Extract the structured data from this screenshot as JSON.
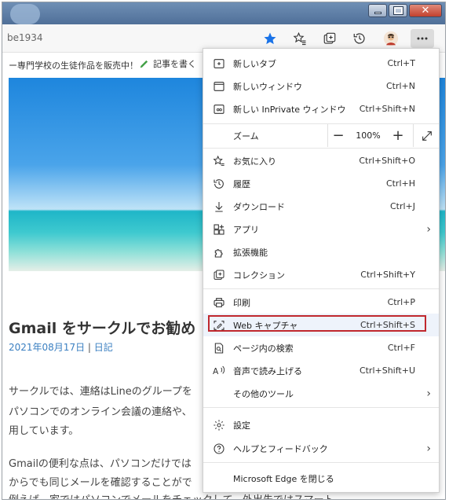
{
  "browser": {
    "url": "be1934",
    "toolbar_icons": [
      "favorite-star-icon",
      "favorites-list-icon",
      "collections-icon",
      "history-icon",
      "profile-avatar",
      "more-menu-icon"
    ]
  },
  "page": {
    "banner_text": "ー専門学校の生徒作品を販売中！",
    "write_button": "記事を書く",
    "article_title": "Gmail をサークルでお勧め",
    "article_date": "2021年08月17日",
    "article_category": "日記",
    "paragraphs": [
      "サークルでは、連絡はLineのグループを",
      "パソコンでのオンライン会議の連絡や、",
      "用しています。",
      "Gmailの便利な点は、パソコンだけでは",
      "からでも同じメールを確認することがで",
      "例えば、家ではパソコンでメールをチェックして、外出先ではスマート"
    ]
  },
  "menu": {
    "items": [
      {
        "label": "新しいタブ",
        "shortcut": "Ctrl+T",
        "icon": "new-tab-icon"
      },
      {
        "label": "新しいウィンドウ",
        "shortcut": "Ctrl+N",
        "icon": "new-window-icon"
      },
      {
        "label": "新しい InPrivate ウィンドウ",
        "shortcut": "Ctrl+Shift+N",
        "icon": "inprivate-icon"
      },
      {
        "label": "ズーム",
        "shortcut": "",
        "icon": ""
      },
      {
        "label": "お気に入り",
        "shortcut": "Ctrl+Shift+O",
        "icon": "favorites-icon"
      },
      {
        "label": "履歴",
        "shortcut": "Ctrl+H",
        "icon": "history-icon"
      },
      {
        "label": "ダウンロード",
        "shortcut": "Ctrl+J",
        "icon": "download-icon"
      },
      {
        "label": "アプリ",
        "shortcut": "",
        "icon": "apps-icon"
      },
      {
        "label": "拡張機能",
        "shortcut": "",
        "icon": "extensions-icon"
      },
      {
        "label": "コレクション",
        "shortcut": "Ctrl+Shift+Y",
        "icon": "collections-icon"
      },
      {
        "label": "印刷",
        "shortcut": "Ctrl+P",
        "icon": "print-icon"
      },
      {
        "label": "Web キャプチャ",
        "shortcut": "Ctrl+Shift+S",
        "icon": "web-capture-icon"
      },
      {
        "label": "ページ内の検索",
        "shortcut": "Ctrl+F",
        "icon": "find-icon"
      },
      {
        "label": "音声で読み上げる",
        "shortcut": "Ctrl+Shift+U",
        "icon": "read-aloud-icon"
      },
      {
        "label": "その他のツール",
        "shortcut": "",
        "icon": ""
      },
      {
        "label": "設定",
        "shortcut": "",
        "icon": "settings-icon"
      },
      {
        "label": "ヘルプとフィードバック",
        "shortcut": "",
        "icon": "help-icon"
      },
      {
        "label": "Microsoft Edge を閉じる",
        "shortcut": "",
        "icon": ""
      }
    ],
    "zoom": {
      "minus": "−",
      "value": "100%",
      "plus": "+"
    },
    "highlight_color": "#c0282e"
  }
}
